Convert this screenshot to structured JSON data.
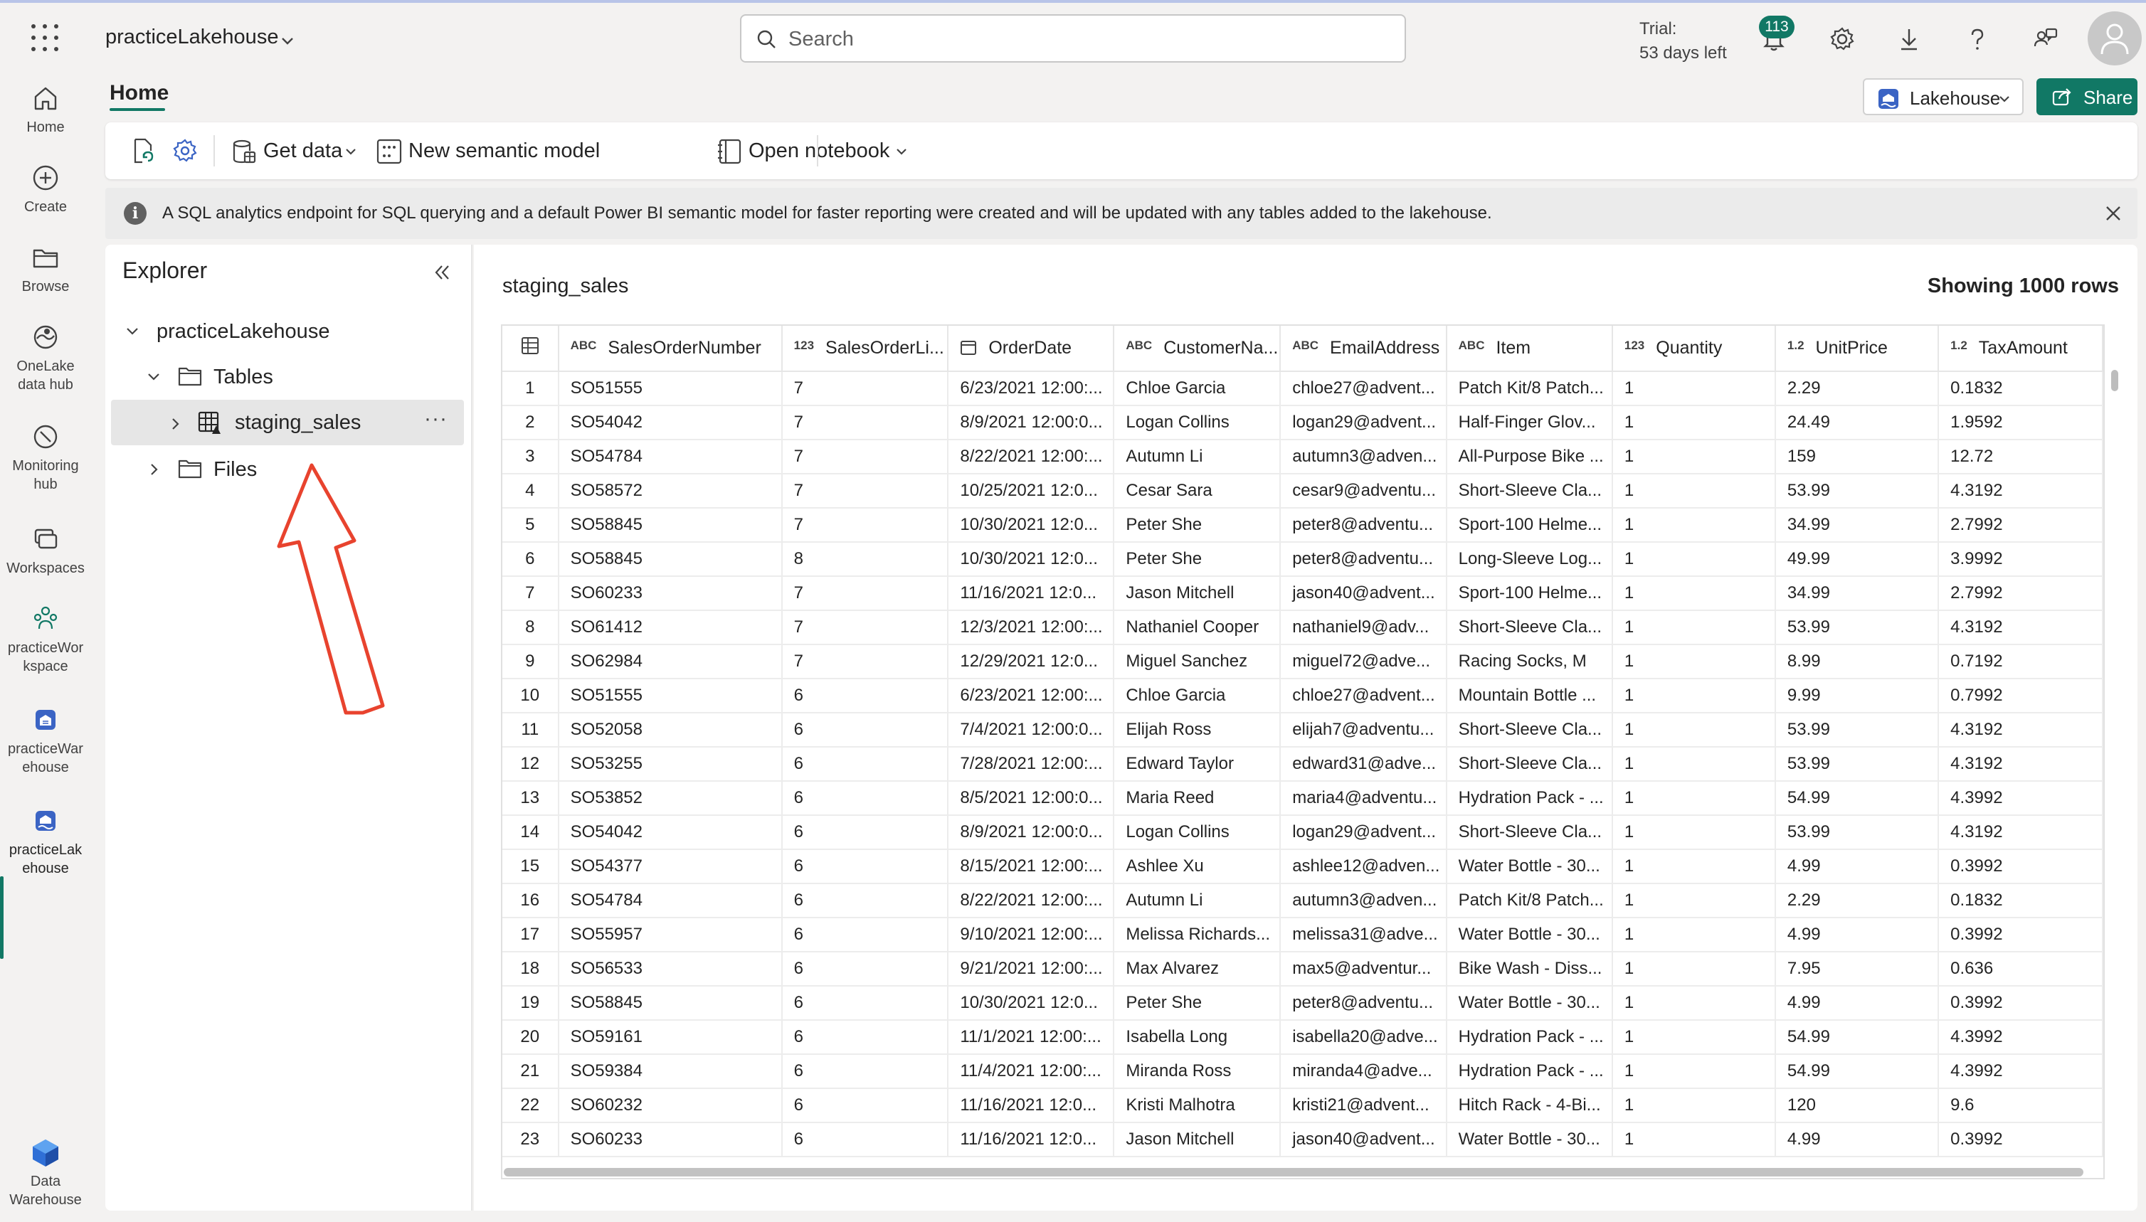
{
  "topbar": {
    "workspace_name": "practiceLakehouse",
    "search_placeholder": "Search",
    "trial_line1": "Trial:",
    "trial_line2": "53 days left",
    "notification_count": "113"
  },
  "leftnav": {
    "items": [
      {
        "label": "Home",
        "icon": "home-icon"
      },
      {
        "label": "Create",
        "icon": "plus-circle-icon"
      },
      {
        "label": "Browse",
        "icon": "folder-icon"
      },
      {
        "label": "OneLake data hub",
        "icon": "onelake-icon"
      },
      {
        "label": "Monitoring hub",
        "icon": "monitor-icon"
      },
      {
        "label": "Workspaces",
        "icon": "workspaces-icon"
      },
      {
        "label": "practiceWorkspace",
        "icon": "workspace-people-icon"
      },
      {
        "label": "practiceWarehouse",
        "icon": "warehouse-icon"
      },
      {
        "label": "practiceLakehouse",
        "icon": "lakehouse-icon"
      },
      {
        "label": "Data Warehouse",
        "icon": "data-warehouse-icon"
      }
    ],
    "label_lines": {
      "onelake_1": "OneLake",
      "onelake_2": "data hub",
      "monitoring_1": "Monitoring",
      "monitoring_2": "hub",
      "ws_1": "practiceWor",
      "ws_2": "kspace",
      "wh_1": "practiceWar",
      "wh_2": "ehouse",
      "lh_1": "practiceLak",
      "lh_2": "ehouse",
      "dw_1": "Data",
      "dw_2": "Warehouse"
    }
  },
  "header": {
    "home_tab": "Home",
    "lakehouse_button": "Lakehouse",
    "share_button": "Share"
  },
  "ribbon": {
    "get_data": "Get data",
    "new_semantic_model": "New semantic model",
    "open_notebook": "Open notebook"
  },
  "infobar": {
    "message": "A SQL analytics endpoint for SQL querying and a default Power BI semantic model for faster reporting were created and will be updated with any tables added to the lakehouse."
  },
  "explorer": {
    "title": "Explorer",
    "root": "practiceLakehouse",
    "tables": "Tables",
    "table_item": "staging_sales",
    "files": "Files"
  },
  "datagrid": {
    "table_name": "staging_sales",
    "row_count": "Showing 1000 rows",
    "columns": [
      {
        "type": "ABC",
        "name": "SalesOrderNumber"
      },
      {
        "type": "123",
        "name": "SalesOrderLi..."
      },
      {
        "type": "date",
        "name": "OrderDate"
      },
      {
        "type": "ABC",
        "name": "CustomerNa..."
      },
      {
        "type": "ABC",
        "name": "EmailAddress"
      },
      {
        "type": "ABC",
        "name": "Item"
      },
      {
        "type": "123",
        "name": "Quantity"
      },
      {
        "type": "1.2",
        "name": "UnitPrice"
      },
      {
        "type": "1.2",
        "name": "TaxAmount"
      }
    ],
    "rows": [
      [
        "1",
        "SO51555",
        "7",
        "6/23/2021 12:00:...",
        "Chloe Garcia",
        "chloe27@advent...",
        "Patch Kit/8 Patch...",
        "1",
        "2.29",
        "0.1832"
      ],
      [
        "2",
        "SO54042",
        "7",
        "8/9/2021 12:00:0...",
        "Logan Collins",
        "logan29@advent...",
        "Half-Finger Glov...",
        "1",
        "24.49",
        "1.9592"
      ],
      [
        "3",
        "SO54784",
        "7",
        "8/22/2021 12:00:...",
        "Autumn Li",
        "autumn3@adven...",
        "All-Purpose Bike ...",
        "1",
        "159",
        "12.72"
      ],
      [
        "4",
        "SO58572",
        "7",
        "10/25/2021 12:0...",
        "Cesar Sara",
        "cesar9@adventu...",
        "Short-Sleeve Cla...",
        "1",
        "53.99",
        "4.3192"
      ],
      [
        "5",
        "SO58845",
        "7",
        "10/30/2021 12:0...",
        "Peter She",
        "peter8@adventu...",
        "Sport-100 Helme...",
        "1",
        "34.99",
        "2.7992"
      ],
      [
        "6",
        "SO58845",
        "8",
        "10/30/2021 12:0...",
        "Peter She",
        "peter8@adventu...",
        "Long-Sleeve Log...",
        "1",
        "49.99",
        "3.9992"
      ],
      [
        "7",
        "SO60233",
        "7",
        "11/16/2021 12:0...",
        "Jason Mitchell",
        "jason40@advent...",
        "Sport-100 Helme...",
        "1",
        "34.99",
        "2.7992"
      ],
      [
        "8",
        "SO61412",
        "7",
        "12/3/2021 12:00:...",
        "Nathaniel Cooper",
        "nathaniel9@adv...",
        "Short-Sleeve Cla...",
        "1",
        "53.99",
        "4.3192"
      ],
      [
        "9",
        "SO62984",
        "7",
        "12/29/2021 12:0...",
        "Miguel Sanchez",
        "miguel72@adve...",
        "Racing Socks, M",
        "1",
        "8.99",
        "0.7192"
      ],
      [
        "10",
        "SO51555",
        "6",
        "6/23/2021 12:00:...",
        "Chloe Garcia",
        "chloe27@advent...",
        "Mountain Bottle ...",
        "1",
        "9.99",
        "0.7992"
      ],
      [
        "11",
        "SO52058",
        "6",
        "7/4/2021 12:00:0...",
        "Elijah Ross",
        "elijah7@adventu...",
        "Short-Sleeve Cla...",
        "1",
        "53.99",
        "4.3192"
      ],
      [
        "12",
        "SO53255",
        "6",
        "7/28/2021 12:00:...",
        "Edward Taylor",
        "edward31@adve...",
        "Short-Sleeve Cla...",
        "1",
        "53.99",
        "4.3192"
      ],
      [
        "13",
        "SO53852",
        "6",
        "8/5/2021 12:00:0...",
        "Maria Reed",
        "maria4@adventu...",
        "Hydration Pack - ...",
        "1",
        "54.99",
        "4.3992"
      ],
      [
        "14",
        "SO54042",
        "6",
        "8/9/2021 12:00:0...",
        "Logan Collins",
        "logan29@advent...",
        "Short-Sleeve Cla...",
        "1",
        "53.99",
        "4.3192"
      ],
      [
        "15",
        "SO54377",
        "6",
        "8/15/2021 12:00:...",
        "Ashlee Xu",
        "ashlee12@adven...",
        "Water Bottle - 30...",
        "1",
        "4.99",
        "0.3992"
      ],
      [
        "16",
        "SO54784",
        "6",
        "8/22/2021 12:00:...",
        "Autumn Li",
        "autumn3@adven...",
        "Patch Kit/8 Patch...",
        "1",
        "2.29",
        "0.1832"
      ],
      [
        "17",
        "SO55957",
        "6",
        "9/10/2021 12:00:...",
        "Melissa Richards...",
        "melissa31@adve...",
        "Water Bottle - 30...",
        "1",
        "4.99",
        "0.3992"
      ],
      [
        "18",
        "SO56533",
        "6",
        "9/21/2021 12:00:...",
        "Max Alvarez",
        "max5@adventur...",
        "Bike Wash - Diss...",
        "1",
        "7.95",
        "0.636"
      ],
      [
        "19",
        "SO58845",
        "6",
        "10/30/2021 12:0...",
        "Peter She",
        "peter8@adventu...",
        "Water Bottle - 30...",
        "1",
        "4.99",
        "0.3992"
      ],
      [
        "20",
        "SO59161",
        "6",
        "11/1/2021 12:00:...",
        "Isabella Long",
        "isabella20@adve...",
        "Hydration Pack - ...",
        "1",
        "54.99",
        "4.3992"
      ],
      [
        "21",
        "SO59384",
        "6",
        "11/4/2021 12:00:...",
        "Miranda Ross",
        "miranda4@adve...",
        "Hydration Pack - ...",
        "1",
        "54.99",
        "4.3992"
      ],
      [
        "22",
        "SO60232",
        "6",
        "11/16/2021 12:0...",
        "Kristi Malhotra",
        "kristi21@advent...",
        "Hitch Rack - 4-Bi...",
        "1",
        "120",
        "9.6"
      ],
      [
        "23",
        "SO60233",
        "6",
        "11/16/2021 12:0...",
        "Jason Mitchell",
        "jason40@advent...",
        "Water Bottle - 30...",
        "1",
        "4.99",
        "0.3992"
      ]
    ]
  },
  "colors": {
    "accent": "#117865",
    "annotation_arrow": "#e8432e"
  }
}
